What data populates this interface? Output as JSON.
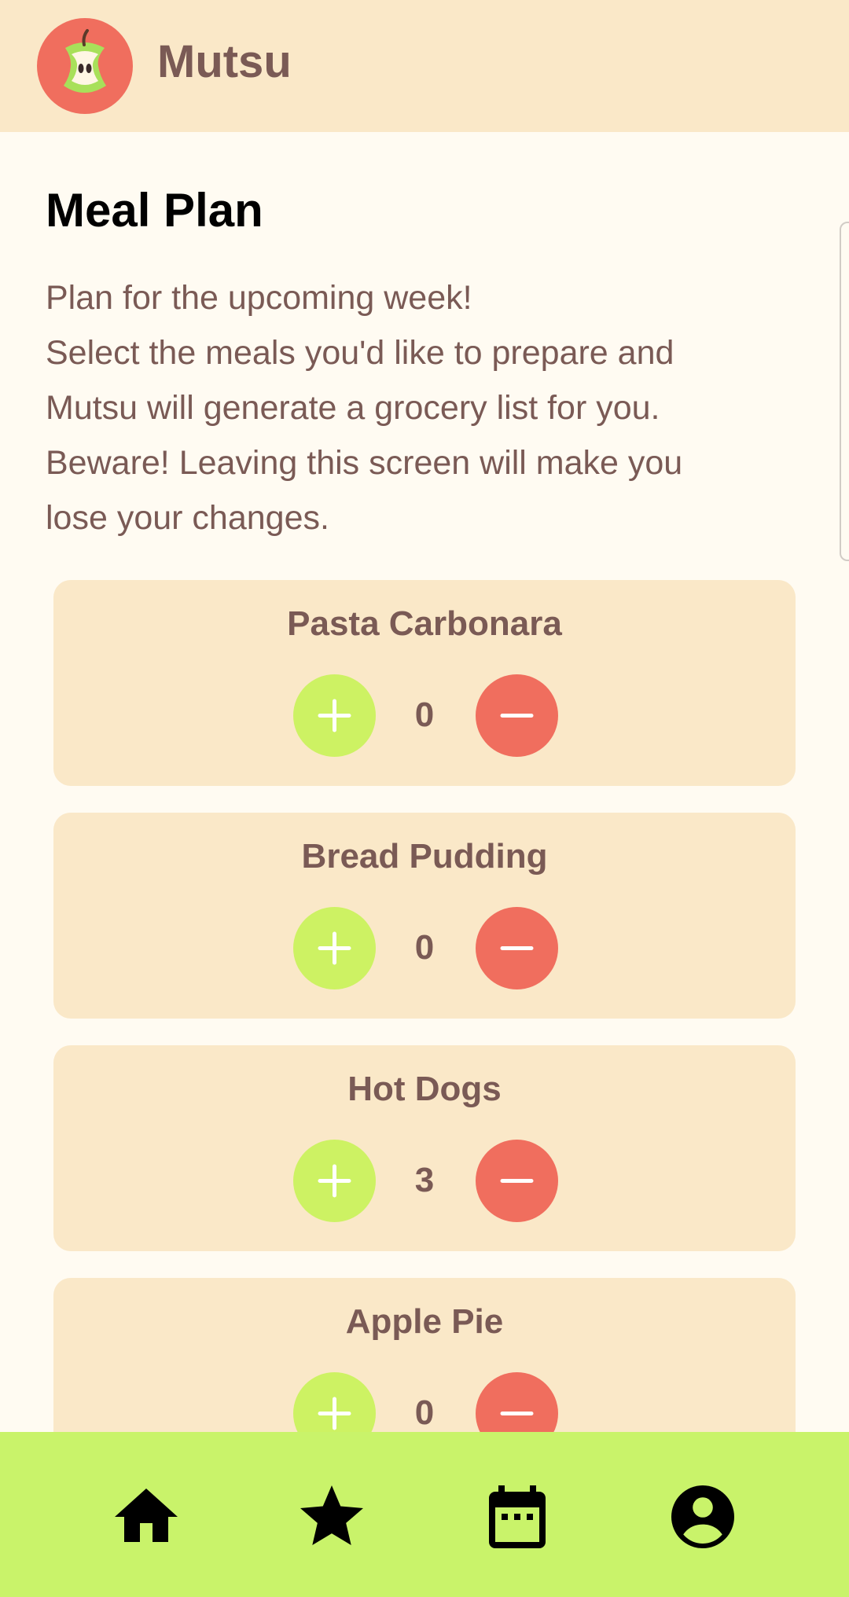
{
  "header": {
    "app_name": "Mutsu",
    "logo_icon": "apple-core-icon",
    "colors": {
      "header_bg": "#FAE8C8",
      "logo_bg": "#F06E5E"
    }
  },
  "main": {
    "title": "Meal Plan",
    "description_lines": [
      "Plan for the upcoming week!",
      "Select the meals you'd like to prepare and",
      "Mutsu will generate a grocery list for you.",
      "Beware! Leaving this screen will make you",
      "lose your changes."
    ],
    "meals": [
      {
        "name": "Pasta Carbonara",
        "count": "0"
      },
      {
        "name": "Bread Pudding",
        "count": "0"
      },
      {
        "name": "Hot Dogs",
        "count": "3"
      },
      {
        "name": "Apple Pie",
        "count": "0"
      }
    ],
    "meal_controls": {
      "increment_icon": "plus-icon",
      "decrement_icon": "minus-icon",
      "increment_color": "#CDF263",
      "decrement_color": "#F06E5E"
    }
  },
  "bottom_nav": {
    "background": "#C9F36A",
    "items": [
      {
        "icon": "home-icon"
      },
      {
        "icon": "star-icon"
      },
      {
        "icon": "calendar-icon"
      },
      {
        "icon": "account-icon"
      }
    ]
  }
}
